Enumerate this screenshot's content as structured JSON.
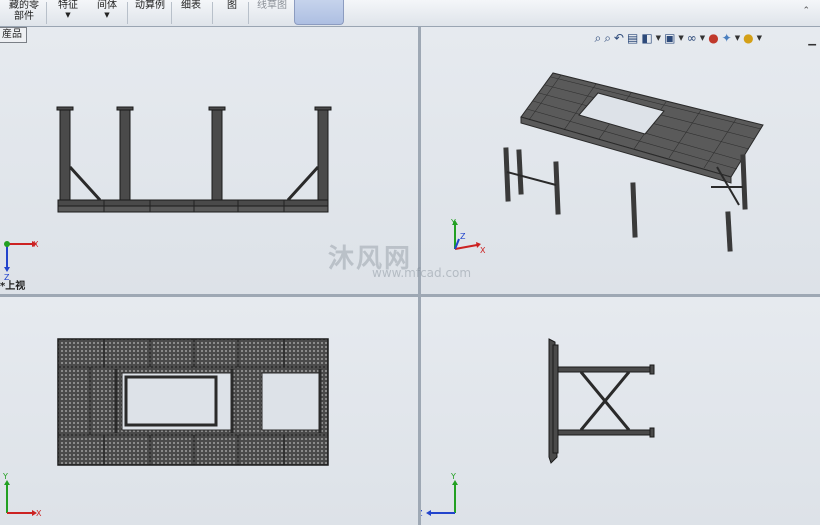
{
  "toolbar": {
    "items": [
      {
        "label_line1": "藏的零",
        "label_line2": "部件",
        "has_arrow": false
      },
      {
        "label_line1": "特征",
        "label_line2": "",
        "has_arrow": true
      },
      {
        "label_line1": "间体",
        "label_line2": "",
        "has_arrow": true
      },
      {
        "label_line1": "动算例",
        "label_line2": "",
        "has_arrow": false
      },
      {
        "label_line1": "细表",
        "label_line2": "",
        "has_arrow": false
      },
      {
        "label_line1": "图",
        "label_line2": "",
        "has_arrow": false
      },
      {
        "label_line1": "线草图",
        "label_line2": "",
        "has_arrow": false
      }
    ],
    "arrow_glyph": "▼",
    "collapse_glyph": "⌃"
  },
  "viewports": {
    "top_left": {
      "tree_tab": "産品",
      "view_label": "*上视"
    },
    "top_right": {},
    "bottom_left": {},
    "bottom_right": {}
  },
  "heads_up_toolbar": {
    "icons": [
      "zoom-to-fit-icon",
      "zoom-area-icon",
      "previous-view-icon",
      "section-view-icon",
      "view-orientation-icon",
      "display-style-icon",
      "hide-show-icon",
      "edit-appearance-icon",
      "apply-scene-icon",
      "view-settings-icon"
    ],
    "minimize_glyph": "▁"
  },
  "triads": {
    "x_label": "X",
    "y_label": "Y",
    "z_label": "Z"
  },
  "watermark": {
    "text": "沐风网",
    "url": "www.mfcad.com"
  },
  "colors": {
    "background": "#dde2e8",
    "steel": "#3a3a3a",
    "axis_x": "#cc2222",
    "axis_y": "#22a022",
    "axis_z": "#2244cc"
  }
}
